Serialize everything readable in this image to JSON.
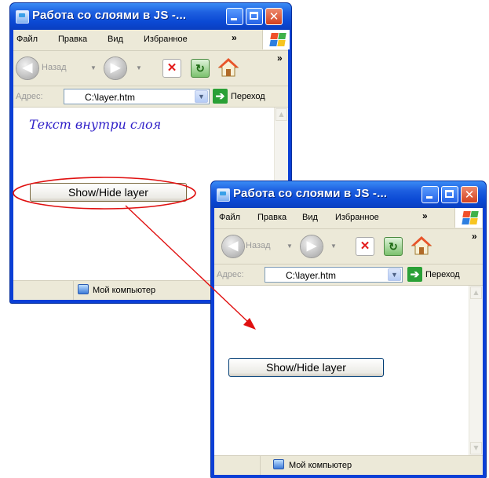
{
  "window_title": "Работа со слоями в JS -...",
  "menu": [
    "Файл",
    "Правка",
    "Вид",
    "Избранное"
  ],
  "menu_more": "»",
  "toolbar": {
    "back_label": "Назад",
    "more": "»"
  },
  "address": {
    "label": "Адрес:",
    "value": "C:\\layer.htm",
    "go_label": "Переход"
  },
  "page": {
    "layer_text": "Текст внутри слоя",
    "button_label": "Show/Hide layer"
  },
  "status": {
    "zone": "Мой компьютер"
  },
  "colors": {
    "annotation": "#e01010",
    "xp_title": "#0a3fd6",
    "layer_text": "#3020c8"
  },
  "icons": [
    "ie-page-icon",
    "minimize-icon",
    "maximize-icon",
    "close-icon",
    "windows-logo-icon",
    "back-icon",
    "forward-icon",
    "stop-icon",
    "refresh-icon",
    "home-icon",
    "go-icon",
    "my-computer-icon"
  ]
}
